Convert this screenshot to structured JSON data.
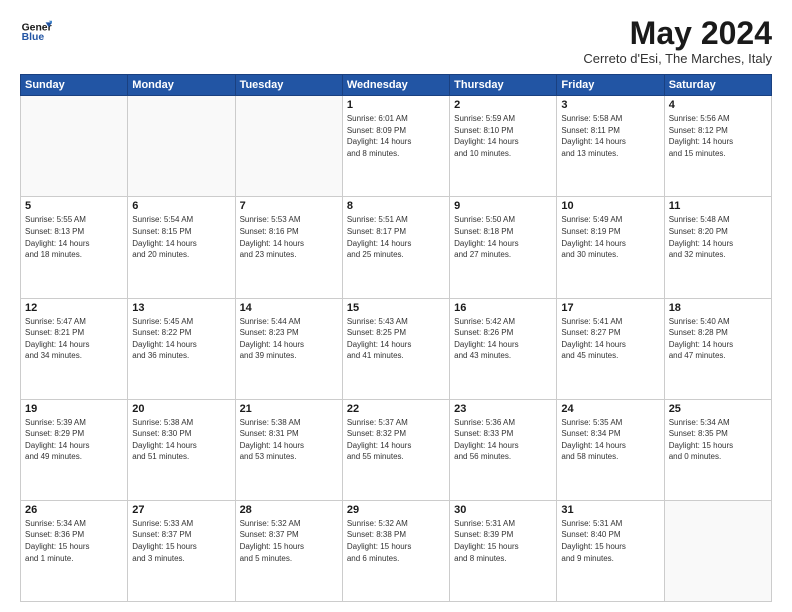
{
  "header": {
    "logo_line1": "General",
    "logo_line2": "Blue",
    "title": "May 2024",
    "subtitle": "Cerreto d'Esi, The Marches, Italy"
  },
  "calendar": {
    "headers": [
      "Sunday",
      "Monday",
      "Tuesday",
      "Wednesday",
      "Thursday",
      "Friday",
      "Saturday"
    ],
    "weeks": [
      [
        {
          "day": "",
          "info": ""
        },
        {
          "day": "",
          "info": ""
        },
        {
          "day": "",
          "info": ""
        },
        {
          "day": "1",
          "info": "Sunrise: 6:01 AM\nSunset: 8:09 PM\nDaylight: 14 hours\nand 8 minutes."
        },
        {
          "day": "2",
          "info": "Sunrise: 5:59 AM\nSunset: 8:10 PM\nDaylight: 14 hours\nand 10 minutes."
        },
        {
          "day": "3",
          "info": "Sunrise: 5:58 AM\nSunset: 8:11 PM\nDaylight: 14 hours\nand 13 minutes."
        },
        {
          "day": "4",
          "info": "Sunrise: 5:56 AM\nSunset: 8:12 PM\nDaylight: 14 hours\nand 15 minutes."
        }
      ],
      [
        {
          "day": "5",
          "info": "Sunrise: 5:55 AM\nSunset: 8:13 PM\nDaylight: 14 hours\nand 18 minutes."
        },
        {
          "day": "6",
          "info": "Sunrise: 5:54 AM\nSunset: 8:15 PM\nDaylight: 14 hours\nand 20 minutes."
        },
        {
          "day": "7",
          "info": "Sunrise: 5:53 AM\nSunset: 8:16 PM\nDaylight: 14 hours\nand 23 minutes."
        },
        {
          "day": "8",
          "info": "Sunrise: 5:51 AM\nSunset: 8:17 PM\nDaylight: 14 hours\nand 25 minutes."
        },
        {
          "day": "9",
          "info": "Sunrise: 5:50 AM\nSunset: 8:18 PM\nDaylight: 14 hours\nand 27 minutes."
        },
        {
          "day": "10",
          "info": "Sunrise: 5:49 AM\nSunset: 8:19 PM\nDaylight: 14 hours\nand 30 minutes."
        },
        {
          "day": "11",
          "info": "Sunrise: 5:48 AM\nSunset: 8:20 PM\nDaylight: 14 hours\nand 32 minutes."
        }
      ],
      [
        {
          "day": "12",
          "info": "Sunrise: 5:47 AM\nSunset: 8:21 PM\nDaylight: 14 hours\nand 34 minutes."
        },
        {
          "day": "13",
          "info": "Sunrise: 5:45 AM\nSunset: 8:22 PM\nDaylight: 14 hours\nand 36 minutes."
        },
        {
          "day": "14",
          "info": "Sunrise: 5:44 AM\nSunset: 8:23 PM\nDaylight: 14 hours\nand 39 minutes."
        },
        {
          "day": "15",
          "info": "Sunrise: 5:43 AM\nSunset: 8:25 PM\nDaylight: 14 hours\nand 41 minutes."
        },
        {
          "day": "16",
          "info": "Sunrise: 5:42 AM\nSunset: 8:26 PM\nDaylight: 14 hours\nand 43 minutes."
        },
        {
          "day": "17",
          "info": "Sunrise: 5:41 AM\nSunset: 8:27 PM\nDaylight: 14 hours\nand 45 minutes."
        },
        {
          "day": "18",
          "info": "Sunrise: 5:40 AM\nSunset: 8:28 PM\nDaylight: 14 hours\nand 47 minutes."
        }
      ],
      [
        {
          "day": "19",
          "info": "Sunrise: 5:39 AM\nSunset: 8:29 PM\nDaylight: 14 hours\nand 49 minutes."
        },
        {
          "day": "20",
          "info": "Sunrise: 5:38 AM\nSunset: 8:30 PM\nDaylight: 14 hours\nand 51 minutes."
        },
        {
          "day": "21",
          "info": "Sunrise: 5:38 AM\nSunset: 8:31 PM\nDaylight: 14 hours\nand 53 minutes."
        },
        {
          "day": "22",
          "info": "Sunrise: 5:37 AM\nSunset: 8:32 PM\nDaylight: 14 hours\nand 55 minutes."
        },
        {
          "day": "23",
          "info": "Sunrise: 5:36 AM\nSunset: 8:33 PM\nDaylight: 14 hours\nand 56 minutes."
        },
        {
          "day": "24",
          "info": "Sunrise: 5:35 AM\nSunset: 8:34 PM\nDaylight: 14 hours\nand 58 minutes."
        },
        {
          "day": "25",
          "info": "Sunrise: 5:34 AM\nSunset: 8:35 PM\nDaylight: 15 hours\nand 0 minutes."
        }
      ],
      [
        {
          "day": "26",
          "info": "Sunrise: 5:34 AM\nSunset: 8:36 PM\nDaylight: 15 hours\nand 1 minute."
        },
        {
          "day": "27",
          "info": "Sunrise: 5:33 AM\nSunset: 8:37 PM\nDaylight: 15 hours\nand 3 minutes."
        },
        {
          "day": "28",
          "info": "Sunrise: 5:32 AM\nSunset: 8:37 PM\nDaylight: 15 hours\nand 5 minutes."
        },
        {
          "day": "29",
          "info": "Sunrise: 5:32 AM\nSunset: 8:38 PM\nDaylight: 15 hours\nand 6 minutes."
        },
        {
          "day": "30",
          "info": "Sunrise: 5:31 AM\nSunset: 8:39 PM\nDaylight: 15 hours\nand 8 minutes."
        },
        {
          "day": "31",
          "info": "Sunrise: 5:31 AM\nSunset: 8:40 PM\nDaylight: 15 hours\nand 9 minutes."
        },
        {
          "day": "",
          "info": ""
        }
      ]
    ]
  }
}
